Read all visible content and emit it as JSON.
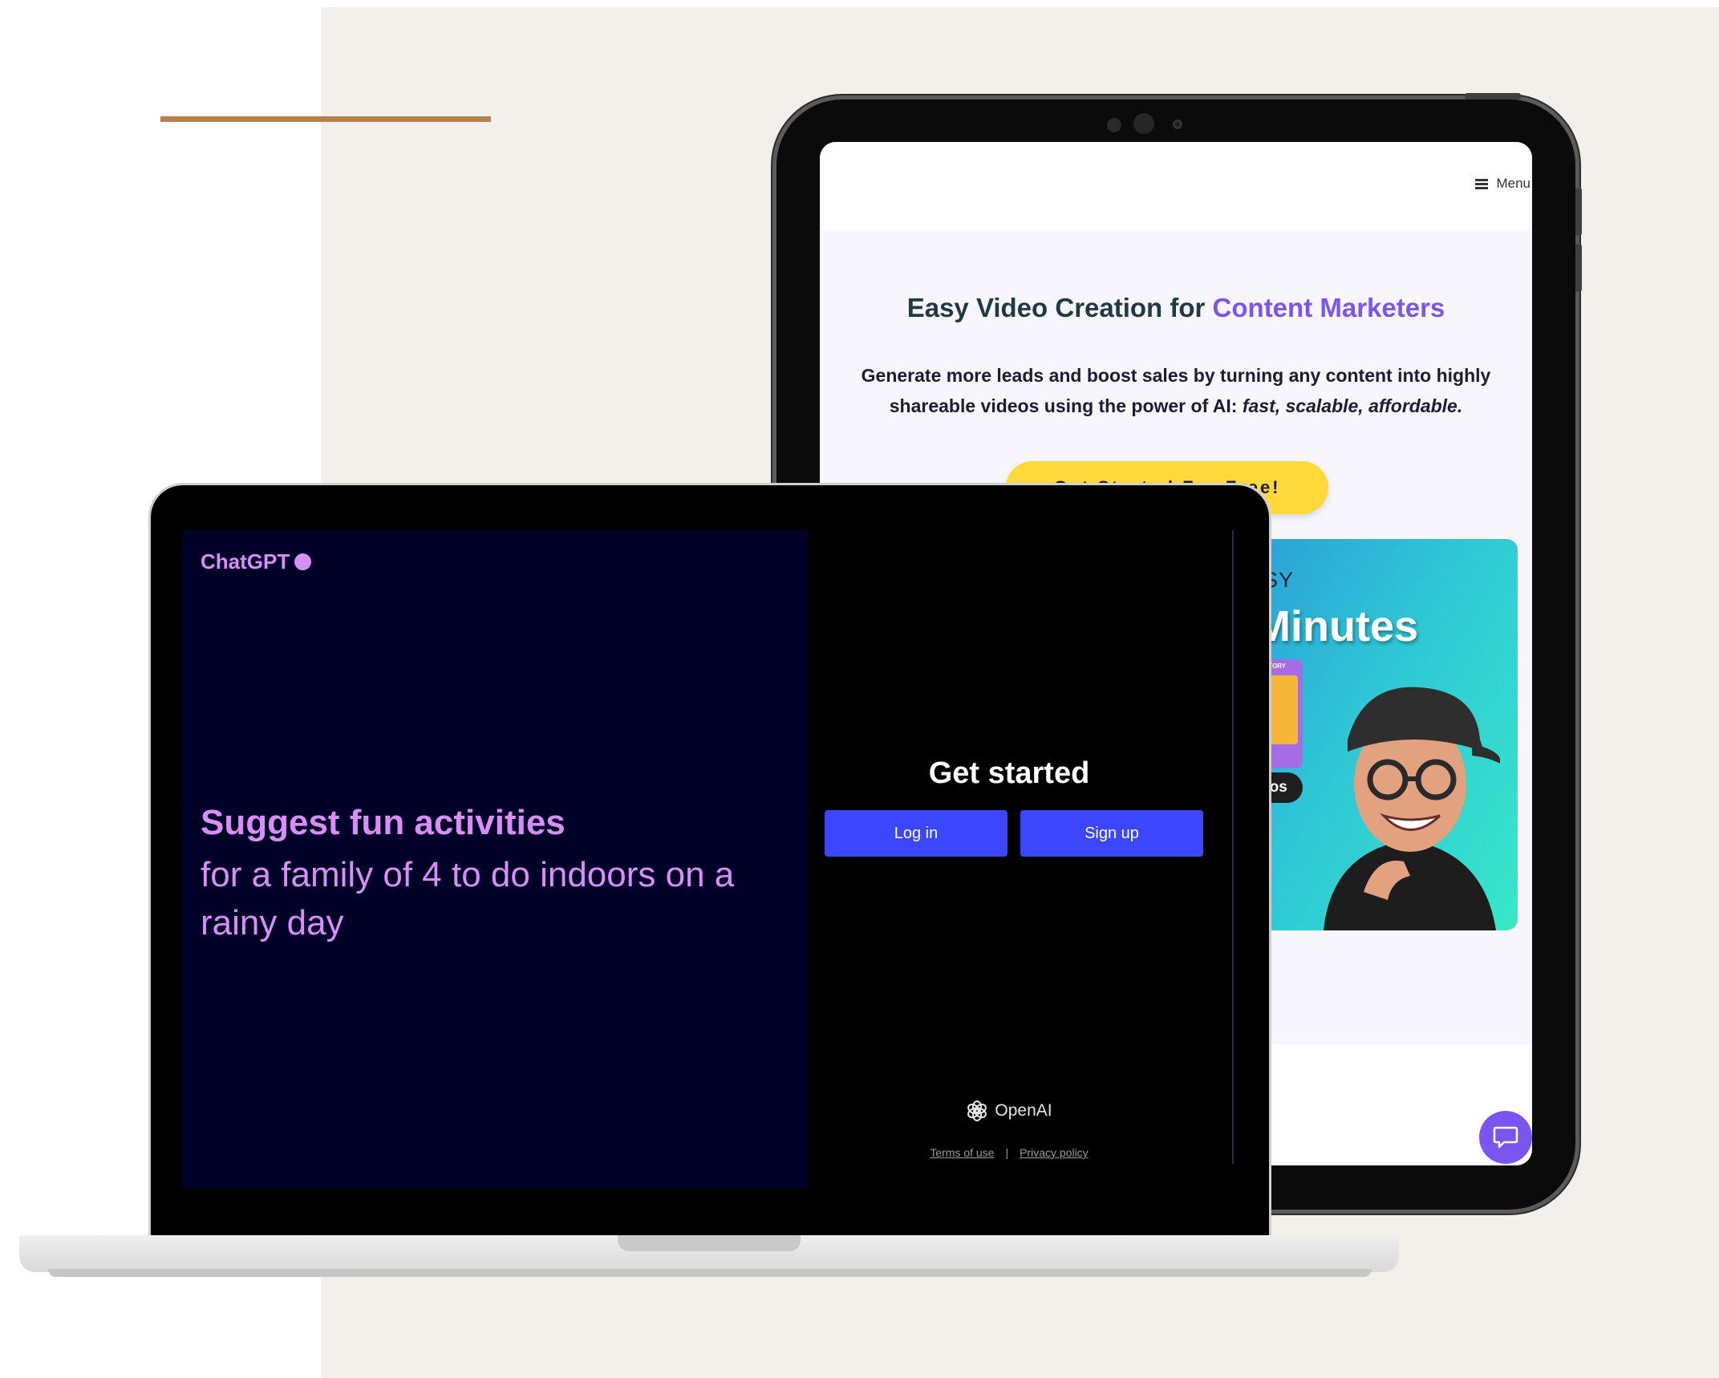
{
  "tablet": {
    "menu_label": "Menu",
    "headline_main": "Easy Video Creation for ",
    "headline_highlight": "Content Marketers",
    "subtitle_main": "Generate more leads and boost sales by turning any content into highly shareable videos using the power of AI: ",
    "subtitle_italic": "fast, scalable, affordable.",
    "cta_label": "Get Started For Free!",
    "hero_word_easy": "ASY",
    "hero_word_minutes": "Minutes",
    "hero_card_tag": "PICTORY",
    "hero_videos_label": "ideos",
    "colors": {
      "accent": "#7b55ef",
      "cta": "#ffd93a",
      "heading": "#1f3a44"
    }
  },
  "laptop": {
    "brand": "ChatGPT",
    "prompt_bold": "Suggest fun activities",
    "prompt_rest": "for a family of 4 to do indoors on a rainy day",
    "get_started": "Get started",
    "login_label": "Log in",
    "signup_label": "Sign up",
    "openai_label": "OpenAI",
    "terms_label": "Terms of use",
    "separator": "|",
    "privacy_label": "Privacy policy",
    "colors": {
      "left_pane": "#000028",
      "prompt": "#d88ef4",
      "button": "#3c46ff"
    }
  },
  "page": {
    "colors": {
      "background": "#f3f0eb",
      "accent_line": "#b4824d"
    }
  }
}
